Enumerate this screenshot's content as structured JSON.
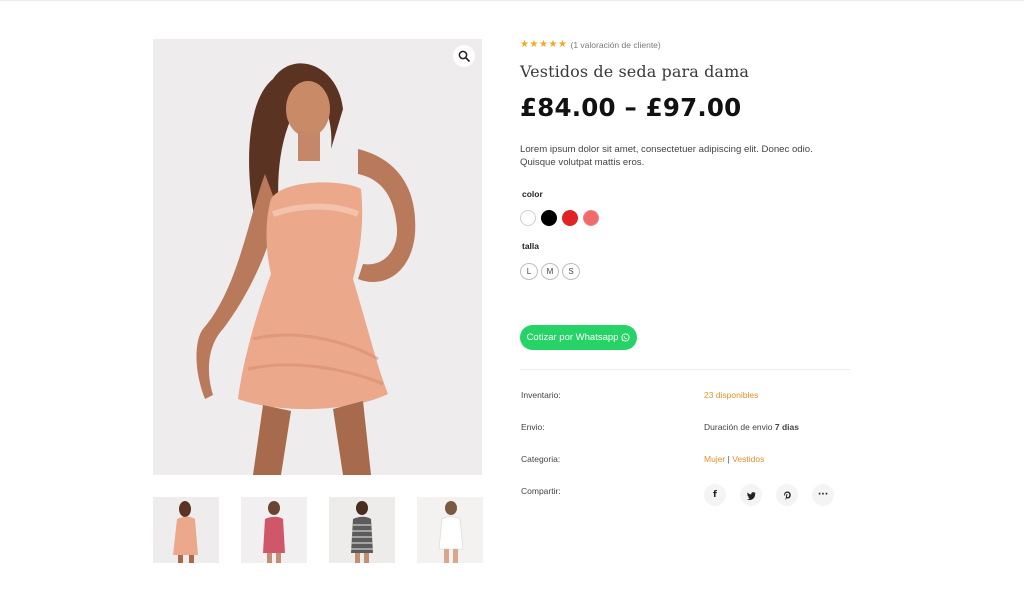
{
  "product": {
    "title": "Vestidos de seda para dama",
    "price_range": "£84.00 – £97.00",
    "rating_text": "(1 valoración de cliente)",
    "rating_value": 5,
    "rating_max": 5,
    "description": "Lorem ipsum dolor sit amet, consectetuer adipiscing elit. Donec odio. Quisque volutpat mattis eros."
  },
  "gallery": {
    "zoom_icon": "search-icon",
    "thumbnails": [
      "peach satin dress",
      "pink dress",
      "gingham dress",
      "white dress"
    ]
  },
  "attributes": {
    "color_label": "color",
    "colors": [
      "#ffffff",
      "#000000",
      "#e02424",
      "#f26a6a"
    ],
    "size_label": "talla",
    "sizes": [
      "L",
      "M",
      "S"
    ]
  },
  "cta": {
    "whatsapp_label": "Cotizar por Whatsapp",
    "color": "#25d366"
  },
  "meta": {
    "inventory_label": "Inventario:",
    "inventory_value": "23 disponibles",
    "shipping_label": "Envio:",
    "shipping_value_prefix": "Duración de envio",
    "shipping_value_bold": "7 dias",
    "category_label": "Categoria:",
    "category_1": "Mujer",
    "category_sep": "|",
    "category_2": "Vestidos",
    "share_label": "Compartir:"
  },
  "share": {
    "facebook": "f",
    "more": "···"
  },
  "accent_color": "#e5932a"
}
